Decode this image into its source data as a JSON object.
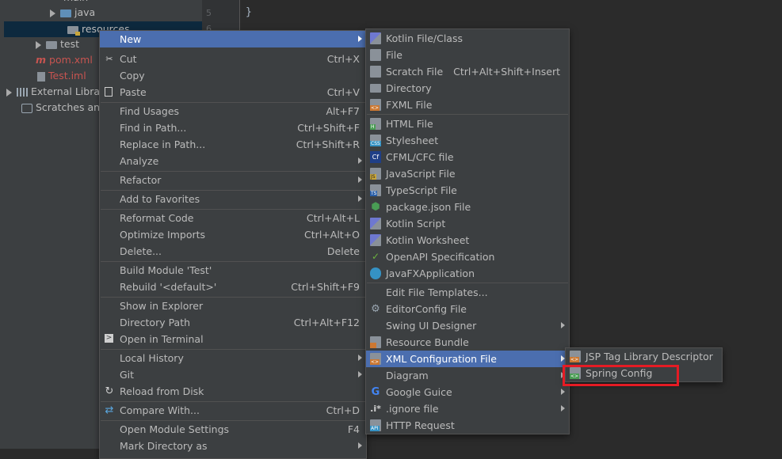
{
  "tree": {
    "items": [
      {
        "label": "main"
      },
      {
        "label": "java"
      },
      {
        "label": "resources"
      },
      {
        "label": "test"
      },
      {
        "label": "pom.xml"
      },
      {
        "label": "Test.iml"
      },
      {
        "label": "External Libra"
      },
      {
        "label": "Scratches and"
      }
    ]
  },
  "gutter": {
    "line5": "5",
    "line6": "6"
  },
  "editor": {
    "code": "}"
  },
  "context_menu": {
    "items": [
      {
        "label": "New"
      },
      {
        "label": "Cut",
        "shortcut": "Ctrl+X"
      },
      {
        "label": "Copy"
      },
      {
        "label": "Paste",
        "shortcut": "Ctrl+V"
      },
      {
        "label": "Find Usages",
        "shortcut": "Alt+F7"
      },
      {
        "label": "Find in Path...",
        "shortcut": "Ctrl+Shift+F"
      },
      {
        "label": "Replace in Path...",
        "shortcut": "Ctrl+Shift+R"
      },
      {
        "label": "Analyze"
      },
      {
        "label": "Refactor"
      },
      {
        "label": "Add to Favorites"
      },
      {
        "label": "Reformat Code",
        "shortcut": "Ctrl+Alt+L"
      },
      {
        "label": "Optimize Imports",
        "shortcut": "Ctrl+Alt+O"
      },
      {
        "label": "Delete...",
        "shortcut": "Delete"
      },
      {
        "label": "Build Module 'Test'"
      },
      {
        "label": "Rebuild '<default>'",
        "shortcut": "Ctrl+Shift+F9"
      },
      {
        "label": "Show in Explorer"
      },
      {
        "label": "Directory Path",
        "shortcut": "Ctrl+Alt+F12"
      },
      {
        "label": "Open in Terminal"
      },
      {
        "label": "Local History"
      },
      {
        "label": "Git"
      },
      {
        "label": "Reload from Disk"
      },
      {
        "label": "Compare With...",
        "shortcut": "Ctrl+D"
      },
      {
        "label": "Open Module Settings",
        "shortcut": "F4"
      },
      {
        "label": "Mark Directory as"
      }
    ]
  },
  "new_menu": {
    "items": [
      {
        "label": "Kotlin File/Class"
      },
      {
        "label": "File"
      },
      {
        "label": "Scratch File",
        "shortcut": "Ctrl+Alt+Shift+Insert"
      },
      {
        "label": "Directory"
      },
      {
        "label": "FXML File"
      },
      {
        "label": "HTML File"
      },
      {
        "label": "Stylesheet"
      },
      {
        "label": "CFML/CFC file"
      },
      {
        "label": "JavaScript File"
      },
      {
        "label": "TypeScript File"
      },
      {
        "label": "package.json File"
      },
      {
        "label": "Kotlin Script"
      },
      {
        "label": "Kotlin Worksheet"
      },
      {
        "label": "OpenAPI Specification"
      },
      {
        "label": "JavaFXApplication"
      },
      {
        "label": "Edit File Templates..."
      },
      {
        "label": "EditorConfig File"
      },
      {
        "label": "Swing UI Designer"
      },
      {
        "label": "Resource Bundle"
      },
      {
        "label": "XML Configuration File"
      },
      {
        "label": "Diagram"
      },
      {
        "label": "Google Guice"
      },
      {
        "label": ".ignore file"
      },
      {
        "label": "HTTP Request"
      }
    ]
  },
  "xml_menu": {
    "items": [
      {
        "label": "JSP Tag Library Descriptor"
      },
      {
        "label": "Spring Config"
      }
    ]
  },
  "icon_badges": {
    "fxml": "<>",
    "html": "H",
    "css": "CSS",
    "cfml": "Cf",
    "js": "JS",
    "ts": "TS",
    "openapi": "✓",
    "xml": "<>",
    "spring": "<>",
    "http": "API",
    "ignore": ".i*"
  },
  "colors": {
    "highlight": "#4b6eaf",
    "menu_bg": "#3c3f41",
    "annotation_box": "#e51b24",
    "error_text": "#c75450"
  }
}
